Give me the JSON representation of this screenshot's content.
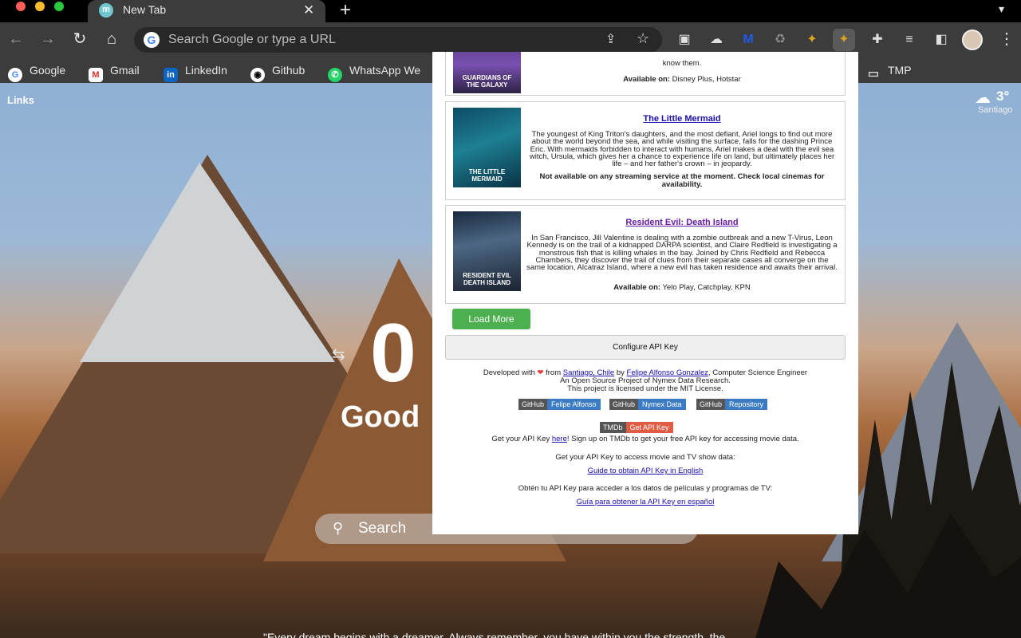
{
  "browser": {
    "tab_title": "New Tab",
    "tab_favicon": "m",
    "omnibox_placeholder": "Search Google or type a URL",
    "bookmarks": [
      {
        "label": "Google",
        "icon": "google-icon"
      },
      {
        "label": "Gmail",
        "icon": "gmail-icon"
      },
      {
        "label": "LinkedIn",
        "icon": "linkedin-icon"
      },
      {
        "label": "Github",
        "icon": "github-icon"
      },
      {
        "label": "WhatsApp We",
        "icon": "whatsapp-icon"
      },
      {
        "label": "TMP",
        "icon": "folder-icon"
      }
    ]
  },
  "newtab": {
    "links_label": "Links",
    "weather_temp": "3°",
    "weather_city": "Santiago",
    "clock": "0",
    "greeting": "Good",
    "search_placeholder": "Search",
    "quote": "\"Every dream begins with a dreamer. Always remember, you have within you the strength, the"
  },
  "popup": {
    "cards": [
      {
        "title": "",
        "poster_label": "GUARDIANS OF THE GALAXY",
        "desc_tail": "know them.",
        "available_label": "Available on:",
        "available_value": "Disney Plus, Hotstar"
      },
      {
        "title": "The Little Mermaid",
        "poster_label": "THE LITTLE MERMAID",
        "description": "The youngest of King Triton's daughters, and the most defiant, Ariel longs to find out more about the world beyond the sea, and while visiting the surface, falls for the dashing Prince Eric. With mermaids forbidden to interact with humans, Ariel makes a deal with the evil sea witch, Ursula, which gives her a chance to experience life on land, but ultimately places her life – and her father's crown – in jeopardy.",
        "unavailable": "Not available on any streaming service at the moment. Check local cinemas for availability."
      },
      {
        "title": "Resident Evil: Death Island",
        "poster_label": "RESIDENT EVIL DEATH ISLAND",
        "description": "In San Francisco, Jill Valentine is dealing with a zombie outbreak and a new T-Virus, Leon Kennedy is on the trail of a kidnapped DARPA scientist, and Claire Redfield is investigating a monstrous fish that is killing whales in the bay. Joined by Chris Redfield and Rebecca Chambers, they discover the trail of clues from their separate cases all converge on the same location, Alcatraz Island, where a new evil has taken residence and awaits their arrival.",
        "available_label": "Available on:",
        "available_value": "Yelo Play, Catchplay, KPN"
      }
    ],
    "load_more": "Load More",
    "configure_api": "Configure API Key",
    "footer": {
      "developed_with": "Developed with",
      "from": "from",
      "city_link": "Santiago, Chile",
      "by": "by",
      "author_link": "Felipe Alfonso Gonzalez",
      "author_role": ", Computer Science Engineer",
      "line2": "An Open Source Project of Nymex Data Research.",
      "line3": "This project is licensed under the MIT License.",
      "badges": [
        {
          "left": "GitHub",
          "right": "Felipe Alfonso"
        },
        {
          "left": "GitHub",
          "right": "Nymex Data"
        },
        {
          "left": "GitHub",
          "right": "Repository"
        }
      ],
      "tmdb_left": "TMDb",
      "tmdb_right": "Get API Key",
      "api_line_pre": "Get your API Key",
      "api_line_link": "here",
      "api_line_post": "! Sign up on TMDb to get your free API key for accessing movie data.",
      "en_heading": "Get your API Key to access movie and TV show data:",
      "en_link": "Guide to obtain API Key in English",
      "es_heading": "Obtén tu API Key para acceder a los datos de películas y programas de TV:",
      "es_link": "Guía para obtener la API Key en español"
    }
  }
}
